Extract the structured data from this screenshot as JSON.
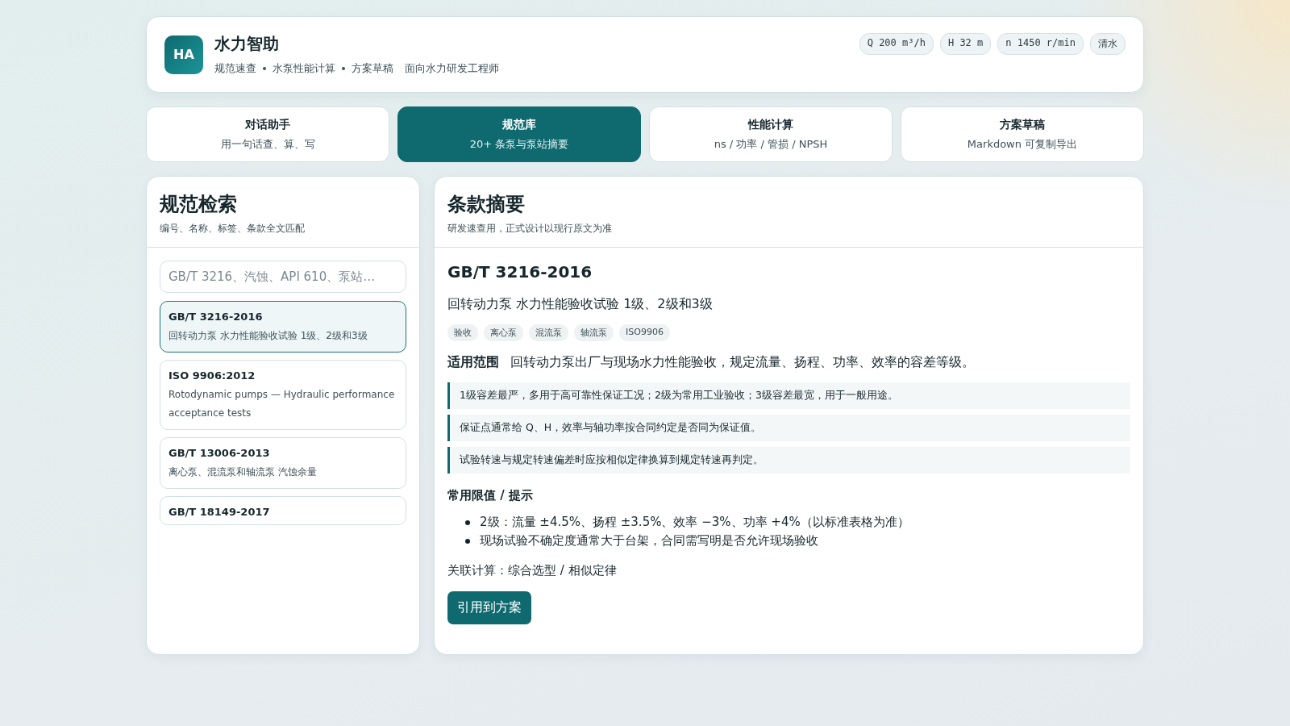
{
  "header": {
    "logo": "HA",
    "title": "水力智助",
    "subtitle": [
      "规范速查",
      "水泵性能计算",
      "方案草稿"
    ],
    "audience": "面向水力研发工程师",
    "chips": [
      {
        "label": "Q 200 m³/h",
        "kind": "mono"
      },
      {
        "label": "H 32 m",
        "kind": "mono"
      },
      {
        "label": "n 1450 r/min",
        "kind": "mono"
      },
      {
        "label": "清水",
        "kind": "text"
      }
    ]
  },
  "tabs": [
    {
      "label": "对话助手",
      "sub": "用一句话查、算、写",
      "selected": false
    },
    {
      "label": "规范库",
      "sub": "20+ 条泵与泵站摘要",
      "selected": true
    },
    {
      "label": "性能计算",
      "sub": "ns / 功率 / 管损 / NPSH",
      "selected": false
    },
    {
      "label": "方案草稿",
      "sub": "Markdown 可复制导出",
      "selected": false
    }
  ],
  "search_panel": {
    "title": "规范检索",
    "subtitle": "编号、名称、标签、条款全文匹配",
    "search": {
      "placeholder": "GB/T 3216、汽蚀、API 610、泵站…"
    },
    "items": [
      {
        "code": "GB/T 3216-2016",
        "name": "回转动力泵 水力性能验收试验 1级、2级和3级",
        "selected": true
      },
      {
        "code": "ISO 9906:2012",
        "name": "Rotodynamic pumps — Hydraulic performance acceptance tests",
        "selected": false
      },
      {
        "code": "GB/T 13006-2013",
        "name": "离心泵、混流泵和轴流泵 汽蚀余量",
        "selected": false
      },
      {
        "code": "GB/T 18149-2017",
        "selected": false
      }
    ]
  },
  "detail_panel": {
    "title": "条款摘要",
    "subtitle": "研发速查用，正式设计以现行原文为准",
    "code": "GB/T 3216-2016",
    "name": "回转动力泵 水力性能验收试验 1级、2级和3级",
    "tags": [
      "验收",
      "离心泵",
      "混流泵",
      "轴流泵",
      "ISO9906"
    ],
    "scope_label": "适用范围",
    "scope": "回转动力泵出厂与现场水力性能验收，规定流量、扬程、功率、效率的容差等级。",
    "notes": [
      "1级容差最严，多用于高可靠性保证工况；2级为常用工业验收；3级容差最宽，用于一般用途。",
      "保证点通常给 Q、H，效率与轴功率按合同约定是否同为保证值。",
      "试验转速与规定转速偏差时应按相似定律换算到规定转速再判定。"
    ],
    "limits_title": "常用限值 / 提示",
    "limits": [
      "2级：流量 ±4.5%、扬程 ±3.5%、效率 −3%、功率 +4%（以标准表格为准）",
      "现场试验不确定度通常大于台架，合同需写明是否允许现场验收"
    ],
    "related": "关联计算：综合选型 / 相似定律",
    "action": "引用到方案"
  }
}
